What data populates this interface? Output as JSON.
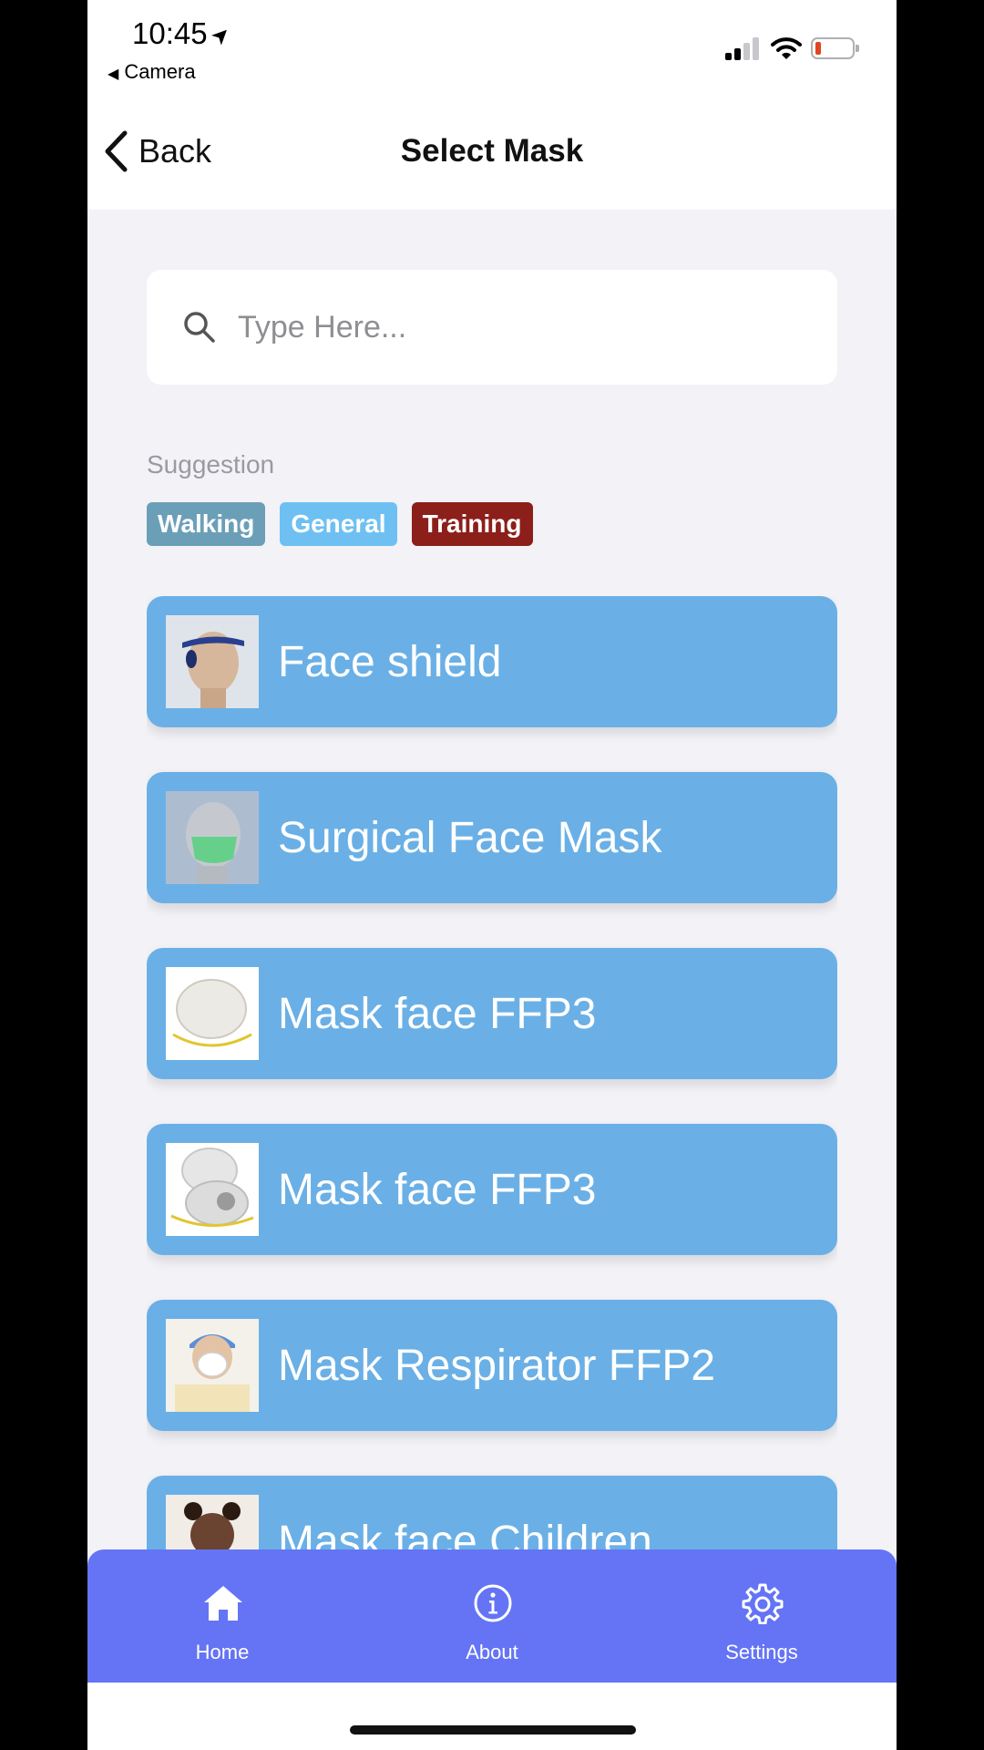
{
  "status_bar": {
    "time": "10:45",
    "location_glyph": "➤",
    "back_app": "Camera",
    "back_glyph": "◀",
    "icons": [
      "location-arrow-icon",
      "signal-icon",
      "wifi-icon",
      "battery-icon"
    ],
    "battery_color": "#e24424"
  },
  "nav": {
    "back_label": "Back",
    "title": "Select Mask"
  },
  "search": {
    "placeholder": "Type Here...",
    "value": ""
  },
  "suggestion": {
    "label": "Suggestion",
    "chips": [
      {
        "label": "Walking",
        "color": "#6b9fb8"
      },
      {
        "label": "General",
        "color": "#6ec0f2"
      },
      {
        "label": "Training",
        "color": "#8c1f1a"
      }
    ]
  },
  "masks": [
    {
      "label": "Face shield",
      "icon": "face-shield-thumb"
    },
    {
      "label": "Surgical Face Mask",
      "icon": "surgical-mask-thumb"
    },
    {
      "label": "Mask face FFP3",
      "icon": "ffp3-mask-thumb"
    },
    {
      "label": "Mask face FFP3",
      "icon": "ffp3-valve-mask-thumb"
    },
    {
      "label": "Mask Respirator FFP2",
      "icon": "ffp2-respirator-thumb"
    },
    {
      "label": "Mask face Children",
      "icon": "children-mask-thumb"
    }
  ],
  "tabs": [
    {
      "label": "Home",
      "icon": "home-icon"
    },
    {
      "label": "About",
      "icon": "info-icon"
    },
    {
      "label": "Settings",
      "icon": "gear-icon"
    }
  ],
  "colors": {
    "card": "#6ab0e6",
    "tab_bar": "#6474f5",
    "background": "#f3f2f7"
  }
}
